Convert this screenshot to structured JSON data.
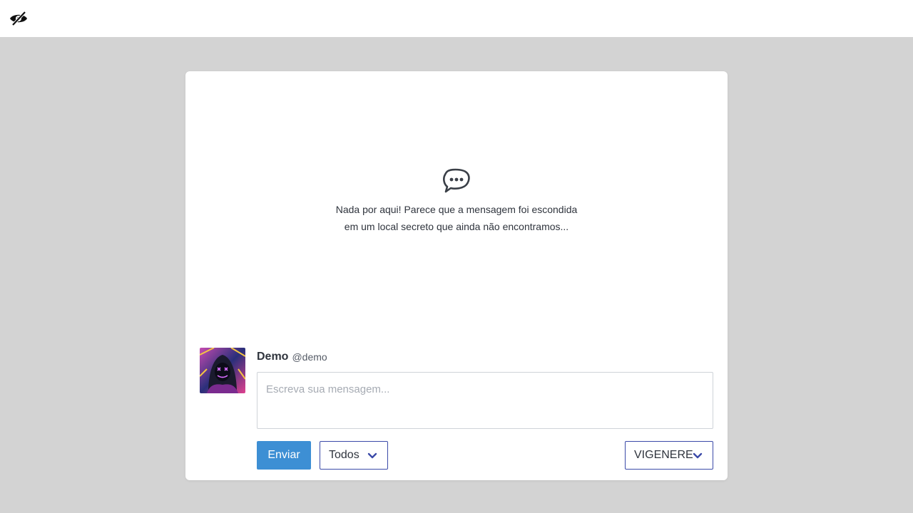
{
  "header": {
    "logo_icon": "eye-slash-icon"
  },
  "empty_state": {
    "icon": "chat-bubble-dots-icon",
    "line1": "Nada por aqui! Parece que a mensagem foi escondida",
    "line2": "em um local secreto que ainda não encontramos..."
  },
  "composer": {
    "user_name": "Demo",
    "user_handle": "@demo",
    "message_placeholder": "Escreva sua mensagem...",
    "send_label": "Enviar",
    "recipient_select": "Todos",
    "cipher_select": "VIGENERE"
  },
  "colors": {
    "background": "#d3d3d3",
    "primary_button": "#3d8fd4",
    "select_border": "#3b4aa8"
  }
}
